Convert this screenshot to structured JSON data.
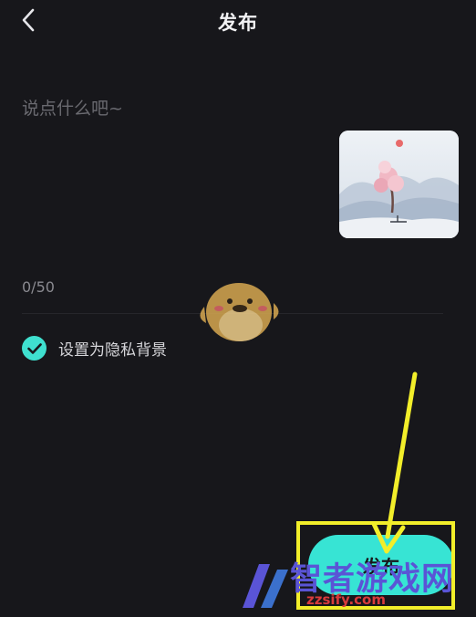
{
  "header": {
    "title": "发布",
    "back_icon": "chevron-left-icon"
  },
  "composer": {
    "placeholder": "说点什么吧~",
    "counter": "0/50"
  },
  "privacy": {
    "label": "设置为隐私背景",
    "checked": true,
    "check_color": "#3fe0cf"
  },
  "publish": {
    "label": "发布",
    "color": "#37e4d4"
  },
  "annotation": {
    "color": "#f2ee2a"
  },
  "watermark": {
    "title": "智者游戏网",
    "url": "zzsify.com"
  }
}
